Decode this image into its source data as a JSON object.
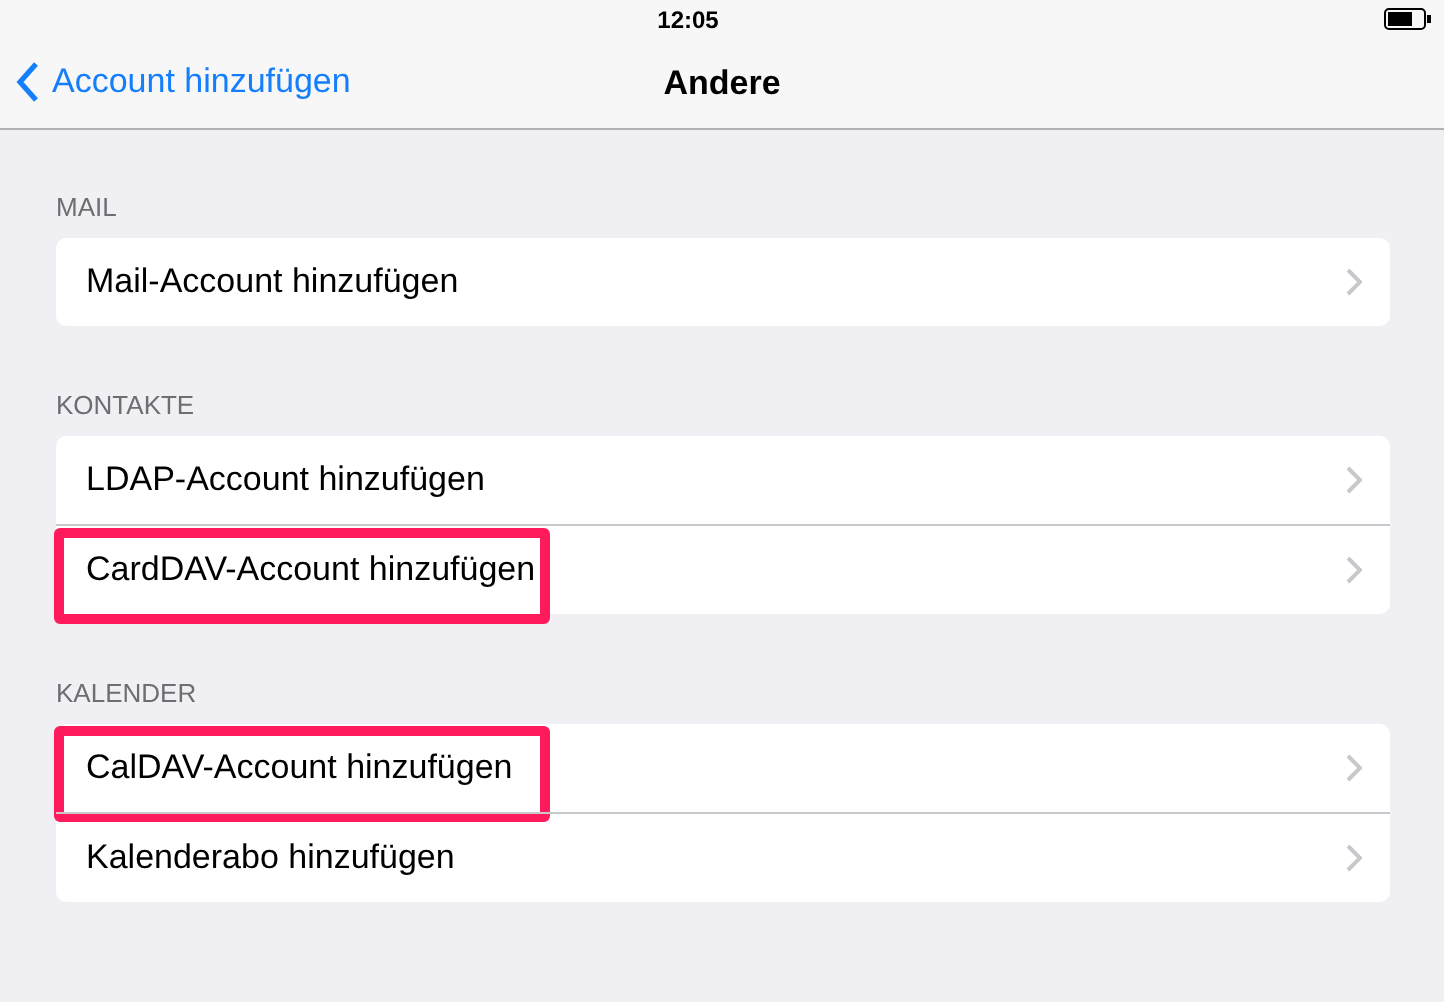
{
  "status_bar": {
    "time": "12:05"
  },
  "nav_bar": {
    "back": "Account hinzufügen",
    "title": "Andere"
  },
  "sections": [
    {
      "header": "MAIL",
      "rows": [
        {
          "label": "Mail-Account hinzufügen",
          "highlighted": false
        }
      ]
    },
    {
      "header": "KONTAKTE",
      "rows": [
        {
          "label": "LDAP-Account hinzufügen",
          "highlighted": false
        },
        {
          "label": "CardDAV-Account hinzufügen",
          "highlighted": true
        }
      ]
    },
    {
      "header": "KALENDER",
      "rows": [
        {
          "label": "CalDAV-Account hinzufügen",
          "highlighted": true
        },
        {
          "label": "Kalenderabo hinzufügen",
          "highlighted": false
        }
      ]
    }
  ]
}
